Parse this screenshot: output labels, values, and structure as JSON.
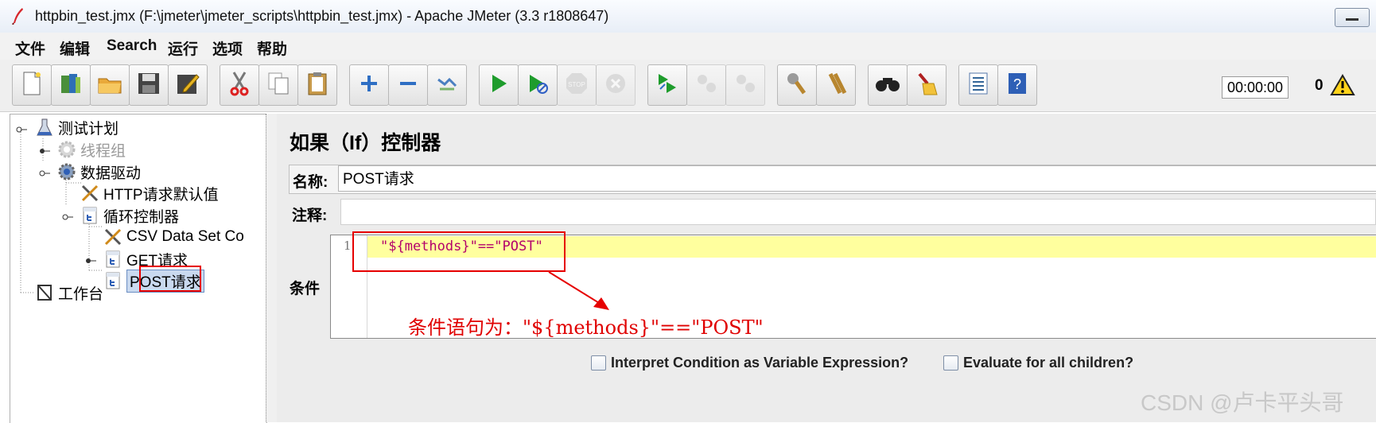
{
  "window": {
    "title": "httpbin_test.jmx (F:\\jmeter\\jmeter_scripts\\httpbin_test.jmx) - Apache JMeter (3.3 r1808647)"
  },
  "menu": [
    "文件",
    "编辑",
    "Search",
    "运行",
    "选项",
    "帮助"
  ],
  "toolbar": {
    "buttons": [
      "new-icon",
      "templates-icon",
      "open-icon",
      "save-icon",
      "save-as-icon",
      "cut-icon",
      "copy-icon",
      "paste-icon",
      "expand-icon",
      "collapse-icon",
      "toggle-icon",
      "start-icon",
      "start-no-pause-icon",
      "stop-icon",
      "shutdown-icon",
      "remote-start-icon",
      "remote-stop-icon",
      "remote-shutdown-icon",
      "clear-icon",
      "clear-all-icon",
      "search-icon",
      "reset-search-icon",
      "function-helper-icon",
      "help-icon"
    ],
    "timer": "00:00:00",
    "warning_count": "0"
  },
  "tree": {
    "nodes": [
      {
        "label": "测试计划",
        "icon": "test-plan-icon"
      },
      {
        "label": "线程组",
        "icon": "thread-group-icon",
        "disabled": true
      },
      {
        "label": "数据驱动",
        "icon": "thread-group-icon"
      },
      {
        "label": "HTTP请求默认值",
        "icon": "config-element-icon"
      },
      {
        "label": "循环控制器",
        "icon": "controller-icon"
      },
      {
        "label": "CSV Data Set Co",
        "icon": "config-element-icon"
      },
      {
        "label": "GET请求",
        "icon": "controller-icon"
      },
      {
        "label": "POST请求",
        "icon": "controller-icon",
        "selected": true
      },
      {
        "label": "工作台",
        "icon": "workbench-icon"
      }
    ]
  },
  "panel": {
    "title": "如果（If）控制器",
    "name_label": "名称:",
    "name_value": "POST请求",
    "comment_label": "注释:",
    "comment_value": "",
    "condition_label": "条件",
    "condition_line_number": "1",
    "condition_code": "\"${methods}\"==\"POST\"",
    "annotation": "条件语句为：\"${methods}\"==\"POST\"",
    "checkbox_1": "Interpret Condition as Variable Expression?",
    "checkbox_2": "Evaluate for all children?"
  },
  "watermark": "CSDN @卢卡平头哥",
  "colors": {
    "annotation_red": "#e60000",
    "code_highlight": "#ffff9e",
    "code_text": "#b3006b"
  }
}
